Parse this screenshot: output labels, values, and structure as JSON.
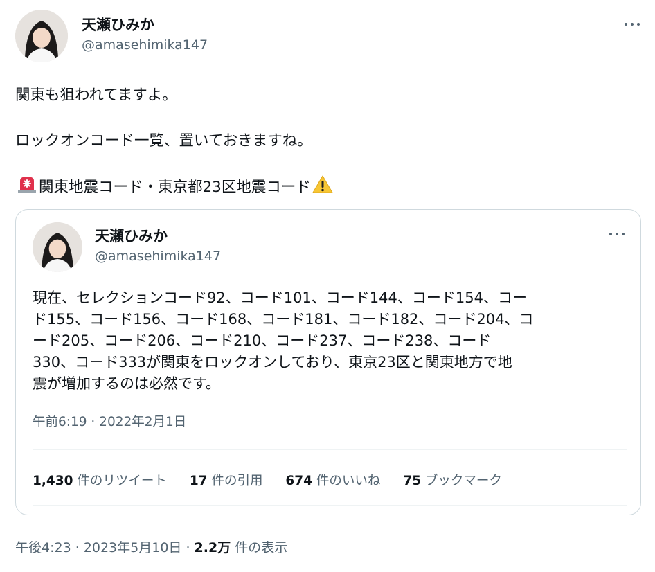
{
  "tweet": {
    "author_name": "天瀬ひみか",
    "author_handle": "@amasehimika147",
    "lines": [
      "関東も狙われてますよ。",
      "ロックオンコード一覧、置いておきますね。"
    ],
    "alert_line": "関東地震コード・東京都23区地震コード",
    "timestamp": "午後4:23 · 2023年5月10日 · ",
    "views_count": "2.2万",
    "views_label": " 件の表示"
  },
  "quote": {
    "author_name": "天瀬ひみか",
    "author_handle": "@amasehimika147",
    "body_lines": [
      "現在、セレクションコード92、コード101、コード144、コード154、コー",
      "ド155、コード156、コード168、コード181、コード182、コード204、コ",
      "ード205、コード206、コード210、コード237、コード238、コード",
      "330、コード333が関東をロックオンしており、東京23区と関東地方で地",
      "震が増加するのは必然です。"
    ],
    "timestamp": "午前6:19 · 2022年2月1日",
    "stats": {
      "retweets_count": "1,430",
      "retweets_label": " 件のリツイート",
      "quotes_count": "17",
      "quotes_label": " 件の引用",
      "likes_count": "674",
      "likes_label": " 件のいいね",
      "bookmarks_count": "75",
      "bookmarks_label": " ブックマーク"
    }
  },
  "icons": {
    "more": "more-horizontal-icon",
    "siren": "rotating-light-emoji",
    "warning": "warning-emoji"
  },
  "colors": {
    "text": "#0f1419",
    "secondary": "#536471",
    "border": "#cfd9de"
  }
}
